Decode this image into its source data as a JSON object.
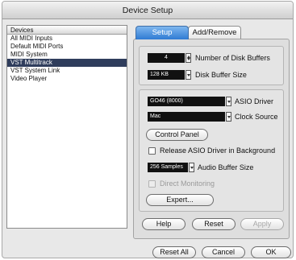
{
  "window": {
    "title": "Device Setup"
  },
  "device_list": {
    "header": "Devices",
    "items": [
      {
        "label": "All MIDI Inputs",
        "selected": false
      },
      {
        "label": "Default MIDI Ports",
        "selected": false
      },
      {
        "label": "MIDI System",
        "selected": false
      },
      {
        "label": "VST Multitrack",
        "selected": true
      },
      {
        "label": "VST System Link",
        "selected": false
      },
      {
        "label": "Video Player",
        "selected": false
      }
    ]
  },
  "tabs": [
    {
      "label": "Setup",
      "active": true
    },
    {
      "label": "Add/Remove",
      "active": false
    }
  ],
  "setup": {
    "disk_buffers": {
      "value": "4",
      "label": "Number of Disk Buffers"
    },
    "disk_buffer_size": {
      "value": "128 KB",
      "label": "Disk Buffer Size"
    },
    "asio_driver": {
      "value": "GO46 (8000)",
      "label": "ASIO Driver"
    },
    "clock_source": {
      "value": "Mac",
      "label": "Clock Source"
    },
    "control_panel_label": "Control Panel",
    "release_asio": {
      "label": "Release ASIO Driver in Background",
      "checked": false
    },
    "audio_buffer_size": {
      "value": "256 Samples",
      "label": "Audio Buffer Size"
    },
    "direct_monitoring": {
      "label": "Direct Monitoring",
      "checked": false,
      "enabled": false
    },
    "expert_label": "Expert...",
    "help_label": "Help",
    "reset_label": "Reset",
    "apply_label": "Apply"
  },
  "footer": {
    "reset_all_label": "Reset All",
    "cancel_label": "Cancel",
    "ok_label": "OK"
  }
}
